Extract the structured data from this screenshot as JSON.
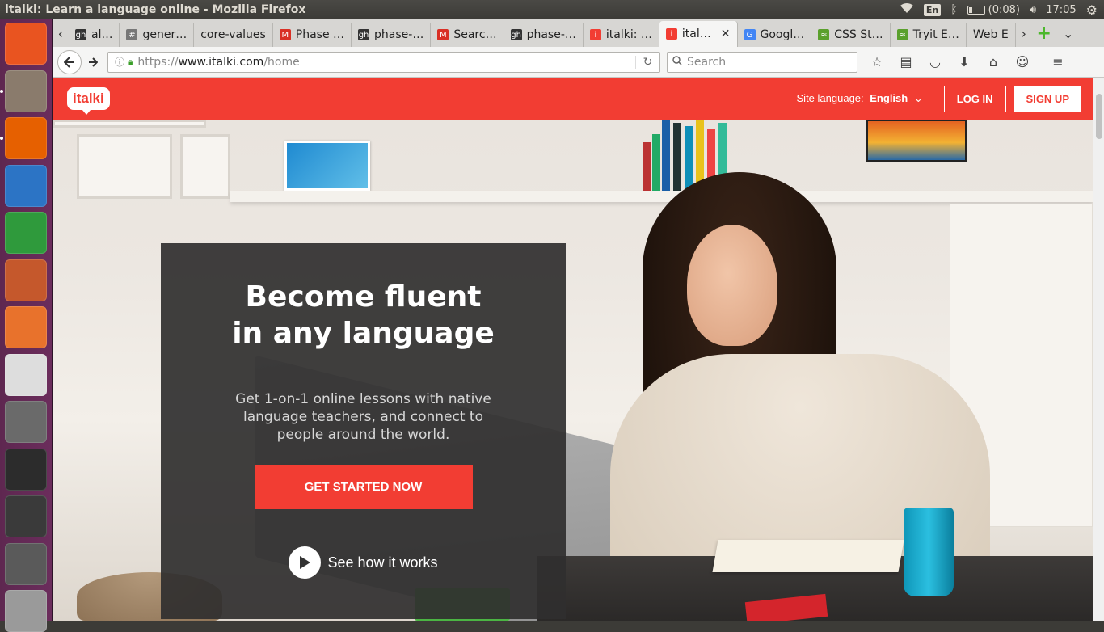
{
  "window": {
    "title": "italki: Learn a language online - Mozilla Firefox"
  },
  "top_panel": {
    "keyboard": "En",
    "battery": "(0:08)",
    "time": "17:05"
  },
  "launcher": {
    "items": [
      {
        "name": "ubuntu-dash-icon",
        "color": "#e95420"
      },
      {
        "name": "files-icon",
        "color": "#8a7b6c"
      },
      {
        "name": "firefox-icon",
        "color": "#e66000"
      },
      {
        "name": "writer-icon",
        "color": "#2c74c5"
      },
      {
        "name": "calc-icon",
        "color": "#2f9a3c"
      },
      {
        "name": "impress-icon",
        "color": "#c5582c"
      },
      {
        "name": "software-center-icon",
        "color": "#e8722c"
      },
      {
        "name": "amazon-icon",
        "color": "#dddddd"
      },
      {
        "name": "system-settings-icon",
        "color": "#6a6a6a"
      },
      {
        "name": "terminal-icon",
        "color": "#2c2c2c"
      },
      {
        "name": "binary-editor-icon",
        "color": "#3a3a3a"
      },
      {
        "name": "sublime-icon",
        "color": "#5a5a5a"
      },
      {
        "name": "workspaces-icon",
        "color": "#9a9a9a"
      }
    ]
  },
  "tabs": [
    {
      "label": "al…",
      "fav": "gh",
      "favcolor": "#333"
    },
    {
      "label": "gener…",
      "fav": "#",
      "favcolor": "#777"
    },
    {
      "label": "core-values",
      "fav": "",
      "favcolor": ""
    },
    {
      "label": "Phase …",
      "fav": "M",
      "favcolor": "#d93025"
    },
    {
      "label": "phase-…",
      "fav": "gh",
      "favcolor": "#333"
    },
    {
      "label": "Searc…",
      "fav": "M",
      "favcolor": "#d93025"
    },
    {
      "label": "phase-…",
      "fav": "gh",
      "favcolor": "#333"
    },
    {
      "label": "italki: …",
      "fav": "i",
      "favcolor": "#f23d33"
    },
    {
      "label": "ital…",
      "fav": "i",
      "favcolor": "#f23d33",
      "active": true
    },
    {
      "label": "Googl…",
      "fav": "G",
      "favcolor": "#4285f4"
    },
    {
      "label": "CSS St…",
      "fav": "≈",
      "favcolor": "#5aa02c"
    },
    {
      "label": "Tryit E…",
      "fav": "≈",
      "favcolor": "#5aa02c"
    },
    {
      "label": "Web E",
      "fav": "",
      "favcolor": ""
    }
  ],
  "navbar": {
    "url_scheme": "https://",
    "url_host": "www.italki.com",
    "url_path": "/home",
    "search_placeholder": "Search"
  },
  "site": {
    "logo": "italki",
    "site_language_label": "Site language:",
    "site_language_value": "English",
    "login": "LOG IN",
    "signup": "SIGN UP",
    "brand_color": "#f23d33"
  },
  "hero": {
    "title_line1": "Become fluent",
    "title_line2": "in any language",
    "subtitle": "Get 1-on-1 online lessons with native language teachers, and connect to people around the world.",
    "cta": "GET STARTED NOW",
    "see_how": "See how it works"
  }
}
